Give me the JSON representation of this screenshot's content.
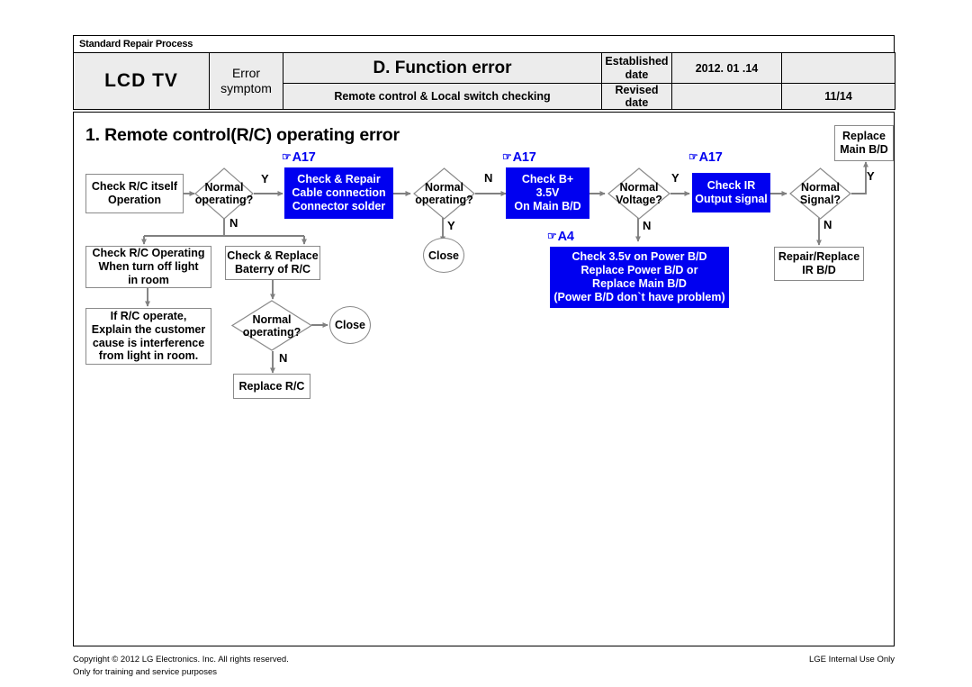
{
  "header": {
    "banner": "Standard Repair Process",
    "product": "LCD  TV",
    "error_symptom_label": "Error symptom",
    "error_symptom_label_line1": "Error",
    "error_symptom_label_line2": "symptom",
    "function_error": "D. Function error",
    "subtitle": "Remote control & Local switch checking",
    "established_label_line1": "Established",
    "established_label_line2": "date",
    "established_date": "2012. 01 .14",
    "revised_label": "Revised date",
    "revised_date": "",
    "established_extra": "",
    "page_number": "11/14"
  },
  "chart_title": "1. Remote control(R/C) operating error",
  "tags": {
    "hand_glyph": "☞",
    "a17_1": "A17",
    "a17_2": "A17",
    "a17_3": "A17",
    "a4": "A4"
  },
  "nodes": {
    "check_rc_itself": "Check R/C itself\nOperation",
    "normal_operating_1": "Normal\noperating?",
    "check_repair_cable": "Check & Repair\nCable connection\nConnector solder",
    "normal_operating_2": "Normal\noperating?",
    "close_1": "Close",
    "check_b_plus": "Check B+\n3.5V\nOn Main B/D",
    "normal_voltage": "Normal\nVoltage?",
    "check_35v_power": "Check 3.5v on Power B/D\nReplace Power B/D or\nReplace Main B/D\n(Power B/D don`t have problem)",
    "check_ir_output": "Check IR\nOutput signal",
    "normal_signal": "Normal\nSignal?",
    "replace_main_bd": "Replace\nMain B/D",
    "repair_replace_ir": "Repair/Replace\nIR B/D",
    "check_rc_operating_light": "Check R/C Operating\nWhen turn off light\nin room",
    "if_rc_operate": "If R/C operate,\nExplain the customer\ncause is interference\nfrom light in room.",
    "check_replace_battery": "Check & Replace\nBaterry of R/C",
    "normal_operating_3": "Normal\noperating?",
    "close_2": "Close",
    "replace_rc": "Replace R/C"
  },
  "branch_labels": {
    "y1": "Y",
    "n1": "N",
    "n2": "N",
    "y2": "Y",
    "n3": "N",
    "y3": "Y",
    "y4": "Y",
    "n4": "N",
    "n5": "N"
  },
  "footer": {
    "copyright": "Copyright © 2012 LG Electronics. Inc. All rights reserved.",
    "purpose": "Only for training and service purposes",
    "internal": "LGE Internal Use Only"
  },
  "colors": {
    "blue": "#0000f0",
    "header_fill": "#ececec",
    "shape_stroke": "#8a8a8a",
    "connector": "#808080"
  }
}
